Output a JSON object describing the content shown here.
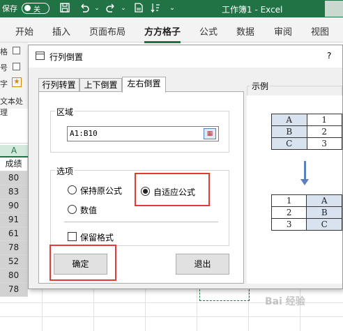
{
  "titlebar": {
    "autosave_label": "保存",
    "autosave_toggle": "关",
    "title": "工作簿1  -  Excel"
  },
  "ribbon": {
    "tabs": [
      "开始",
      "插入",
      "页面布局",
      "方方格子",
      "公式",
      "数据",
      "审阅",
      "视图"
    ],
    "active_tab": "方方格子",
    "partial_labels": [
      "格",
      "号",
      "字",
      "文本处理"
    ]
  },
  "sheet": {
    "column_header": "A",
    "rows": [
      "成绩",
      "80",
      "83",
      "90",
      "91",
      "61",
      "78",
      "52",
      "80",
      "78"
    ]
  },
  "dialog": {
    "title": "行列倒置",
    "help": "?",
    "tabs": [
      "行列转置",
      "上下倒置",
      "左右倒置"
    ],
    "active_tab": "左右倒置",
    "area": {
      "label": "区域",
      "value": "A1:B10"
    },
    "options": {
      "label": "选项",
      "keep_formula": "保持原公式",
      "adaptive_formula": "自适应公式",
      "value_only": "数值",
      "selected": "自适应公式",
      "keep_format": "保留格式",
      "keep_format_checked": false
    },
    "buttons": {
      "ok": "确定",
      "exit": "退出"
    },
    "example": {
      "label": "示例",
      "before": [
        [
          "A",
          "1"
        ],
        [
          "B",
          "2"
        ],
        [
          "C",
          "3"
        ]
      ],
      "after": [
        [
          "1",
          "A"
        ],
        [
          "2",
          "B"
        ],
        [
          "3",
          "C"
        ]
      ]
    }
  },
  "watermark": "Bai 经验",
  "colors": {
    "excel_green": "#217346",
    "highlight_red": "#e53935",
    "example_blue": "#d9e3f0",
    "arrow_blue": "#5b82be"
  }
}
